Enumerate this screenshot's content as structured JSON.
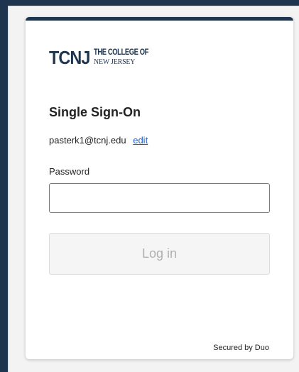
{
  "logo": {
    "wordmark": "TCNJ",
    "line1": "THE COLLEGE OF",
    "line2": "NEW JERSEY"
  },
  "title": "Single Sign-On",
  "account": {
    "email": "pasterk1@tcnj.edu",
    "edit_label": "edit"
  },
  "password": {
    "label": "Password",
    "value": "",
    "placeholder": ""
  },
  "login_button": {
    "label": "Log in"
  },
  "footer": {
    "secured_text": "Secured by Duo"
  },
  "colors": {
    "brand_navy": "#1e3550",
    "link_blue": "#1a5fd6",
    "disabled_text": "#b0b0b0"
  }
}
